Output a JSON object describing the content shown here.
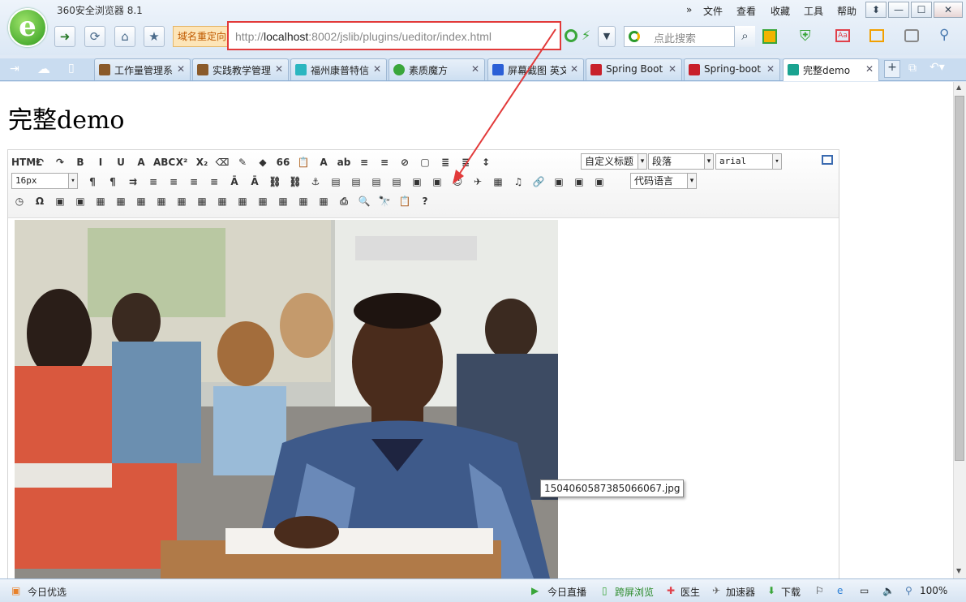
{
  "window": {
    "title": "360安全浏览器 8.1",
    "menu": [
      "文件",
      "查看",
      "收藏",
      "工具",
      "帮助"
    ],
    "controls": [
      "⬍",
      "—",
      "☐",
      "✕"
    ]
  },
  "nav": {
    "redirect_label": "域名重定向",
    "url_scheme": "http://",
    "url_host": "localhost",
    "url_rest": ":8002/jslib/plugins/ueditor/index.html",
    "search_placeholder": "点此搜索"
  },
  "tabs": [
    {
      "label": "工作量管理系统",
      "color": "#8a5a2a"
    },
    {
      "label": "实践教学管理系",
      "color": "#8a5a2a"
    },
    {
      "label": "福州康普特信息",
      "color": "#2bb6c0"
    },
    {
      "label": "素质魔方",
      "color": "#3aa63a"
    },
    {
      "label": "屏幕截图 英文",
      "color": "#2b5fd6"
    },
    {
      "label": "Spring Boot",
      "color": "#c8202a"
    },
    {
      "label": "Spring-boot",
      "color": "#c8202a"
    },
    {
      "label": "完整demo",
      "color": "#1aa390"
    }
  ],
  "tab_close": "✕",
  "page": {
    "title": "完整demo"
  },
  "editor": {
    "row1": [
      "HTML",
      "↶",
      "↷",
      "B",
      "I",
      "U",
      "A",
      "ABC",
      "X²",
      "X₂",
      "⌫",
      "✎",
      "◆",
      "66",
      "📋",
      "A",
      "ab",
      "≡",
      "≡",
      "⊘",
      "▢",
      "≣",
      "≣",
      "↕"
    ],
    "heading_select": "自定义标题",
    "paragraph_select": "段落",
    "font_select": "arial",
    "fontsize_select": "16px",
    "code_select": "代码语言",
    "row2": [
      "¶",
      "¶",
      "⇉",
      "≡",
      "≡",
      "≡",
      "≡",
      "Ā",
      "Ā",
      "⛓",
      "⛓",
      "⚓",
      "▤",
      "▤",
      "▤",
      "▤",
      "▣",
      "▣",
      "☺",
      "✈",
      "▦",
      "♫",
      "🔗",
      "▣",
      "▣",
      "▣"
    ],
    "row3": [
      "◷",
      "Ω",
      "▣",
      "▣",
      "▦",
      "▦",
      "▦",
      "▦",
      "▦",
      "▦",
      "▦",
      "▦",
      "▦",
      "▦",
      "▦",
      "▦",
      "⎙",
      "🔍",
      "🔭",
      "📋",
      "?"
    ]
  },
  "image_tooltip": "1504060587385066067.jpg",
  "status": {
    "left": "今日优选",
    "items": [
      "今日直播",
      "跨屏浏览",
      "医生",
      "加速器",
      "下载"
    ],
    "zoom": "100%"
  }
}
